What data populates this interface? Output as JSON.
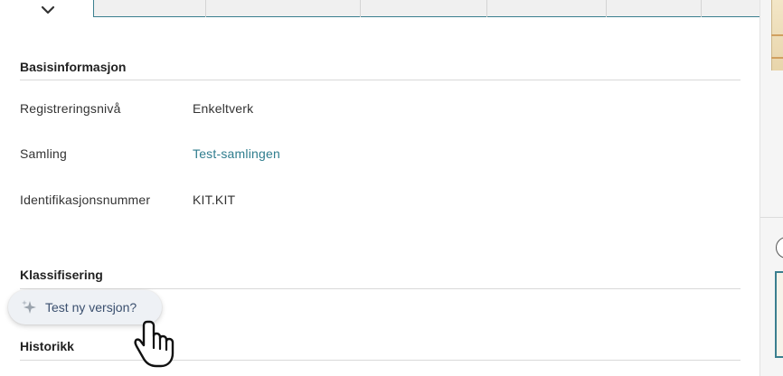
{
  "sections": {
    "basic_info": {
      "title": "Basisinformasjon",
      "fields": [
        {
          "label": "Registreringsnivå",
          "value": "Enkeltverk"
        },
        {
          "label": "Samling",
          "value": "Test-samlingen"
        },
        {
          "label": "Identifikasjonsnummer",
          "value": "KIT.KIT"
        }
      ]
    },
    "classification": {
      "title": "Klassifisering"
    },
    "history": {
      "title": "Historikk"
    }
  },
  "floating_button": {
    "label": "Test ny versjon?",
    "icon": "sparkle-icon"
  },
  "icons": {
    "collapse": "chevron-down-icon",
    "cursor": "hand-pointer-icon"
  },
  "colors": {
    "link": "#2f7d8e",
    "accent": "#3b7f8f",
    "pill_bg": "#eef1f5"
  }
}
